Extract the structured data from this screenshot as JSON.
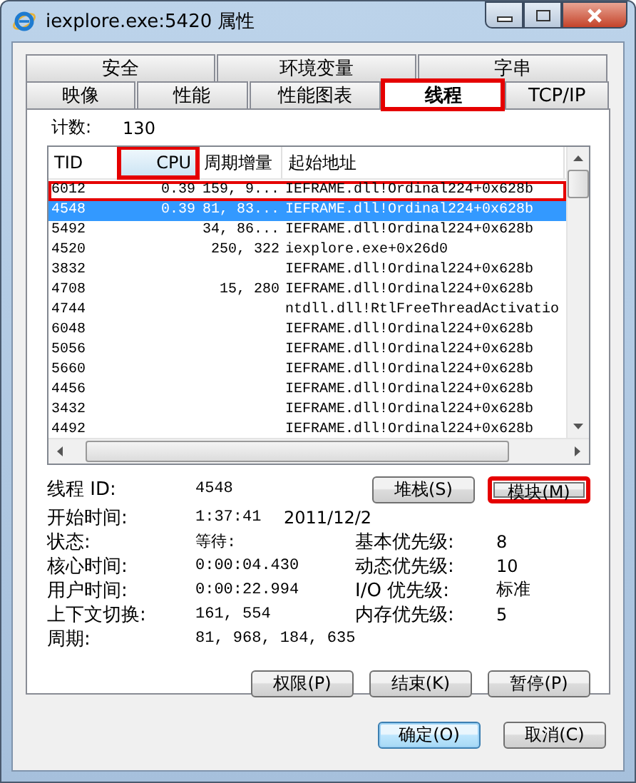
{
  "window": {
    "title": "iexplore.exe:5420 属性"
  },
  "tab_rows": [
    {
      "tabs": [
        {
          "label": "安全",
          "selected": false,
          "highlighted": false
        },
        {
          "label": "环境变量",
          "selected": false,
          "highlighted": false
        },
        {
          "label": "字串",
          "selected": false,
          "highlighted": false
        }
      ]
    },
    {
      "tabs": [
        {
          "label": "映像",
          "selected": false,
          "highlighted": false
        },
        {
          "label": "性能",
          "selected": false,
          "highlighted": false
        },
        {
          "label": "性能图表",
          "selected": false,
          "highlighted": false
        },
        {
          "label": "线程",
          "selected": true,
          "highlighted": true
        },
        {
          "label": "TCP/IP",
          "selected": false,
          "highlighted": false
        }
      ]
    }
  ],
  "count": {
    "label": "计数:",
    "value": "130"
  },
  "thread_table": {
    "columns": [
      {
        "label": "TID",
        "sorted": false,
        "highlighted": false
      },
      {
        "label": "CPU",
        "sorted": true,
        "highlighted": true
      },
      {
        "label": "周期增量",
        "sorted": false,
        "highlighted": false
      },
      {
        "label": "起始地址",
        "sorted": false,
        "highlighted": false
      }
    ],
    "rows": [
      {
        "cells": [
          "6012",
          "0.39",
          "159, 9...",
          "IEFRAME.dll!Ordinal224+0x628b"
        ],
        "selected": false,
        "highlighted": true
      },
      {
        "cells": [
          "4548",
          "0.39",
          "81, 83...",
          "IEFRAME.dll!Ordinal224+0x628b"
        ],
        "selected": true,
        "highlighted": false
      },
      {
        "cells": [
          "5492",
          "",
          "34, 86...",
          "IEFRAME.dll!Ordinal224+0x628b"
        ],
        "selected": false,
        "highlighted": false
      },
      {
        "cells": [
          "4520",
          "",
          "250, 322",
          "iexplore.exe+0x26d0"
        ],
        "selected": false,
        "highlighted": false
      },
      {
        "cells": [
          "3832",
          "",
          "",
          "IEFRAME.dll!Ordinal224+0x628b"
        ],
        "selected": false,
        "highlighted": false
      },
      {
        "cells": [
          "4708",
          "",
          "15, 280",
          "IEFRAME.dll!Ordinal224+0x628b"
        ],
        "selected": false,
        "highlighted": false
      },
      {
        "cells": [
          "4744",
          "",
          "",
          "ntdll.dll!RtlFreeThreadActivatio"
        ],
        "selected": false,
        "highlighted": false
      },
      {
        "cells": [
          "6048",
          "",
          "",
          "IEFRAME.dll!Ordinal224+0x628b"
        ],
        "selected": false,
        "highlighted": false
      },
      {
        "cells": [
          "5056",
          "",
          "",
          "IEFRAME.dll!Ordinal224+0x628b"
        ],
        "selected": false,
        "highlighted": false
      },
      {
        "cells": [
          "5660",
          "",
          "",
          "IEFRAME.dll!Ordinal224+0x628b"
        ],
        "selected": false,
        "highlighted": false
      },
      {
        "cells": [
          "4456",
          "",
          "",
          "IEFRAME.dll!Ordinal224+0x628b"
        ],
        "selected": false,
        "highlighted": false
      },
      {
        "cells": [
          "3432",
          "",
          "",
          "IEFRAME.dll!Ordinal224+0x628b"
        ],
        "selected": false,
        "highlighted": false
      },
      {
        "cells": [
          "4492",
          "",
          "",
          "IEFRAME.dll!Ordinal224+0x628b"
        ],
        "selected": false,
        "highlighted": false
      }
    ]
  },
  "thread_id": {
    "label": "线程 ID:",
    "value": "4548"
  },
  "thread_buttons": [
    {
      "label": "堆栈(S)",
      "highlighted": false
    },
    {
      "label": "模块(M)",
      "highlighted": true
    }
  ],
  "start_time": {
    "label": "开始时间:",
    "time": "1:37:41",
    "date": "2011/12/2"
  },
  "details": [
    {
      "label": "状态:",
      "value": "等待:",
      "label2": "基本优先级:",
      "value2": "8"
    },
    {
      "label": "核心时间:",
      "value": "0:00:04.430",
      "label2": "动态优先级:",
      "value2": "10"
    },
    {
      "label": "用户时间:",
      "value": "0:00:22.994",
      "label2": "I/O 优先级:",
      "value2": "标准"
    },
    {
      "label": "上下文切换:",
      "value": "161, 554",
      "label2": "内存优先级:",
      "value2": "5"
    }
  ],
  "cycles": {
    "label": "周期:",
    "value": "81, 968, 184, 635"
  },
  "action_buttons": [
    {
      "label": "权限(P)"
    },
    {
      "label": "结束(K)"
    },
    {
      "label": "暂停(P)"
    }
  ],
  "dialog_buttons": [
    {
      "label": "确定(O)",
      "default": true
    },
    {
      "label": "取消(C)",
      "default": false
    }
  ]
}
